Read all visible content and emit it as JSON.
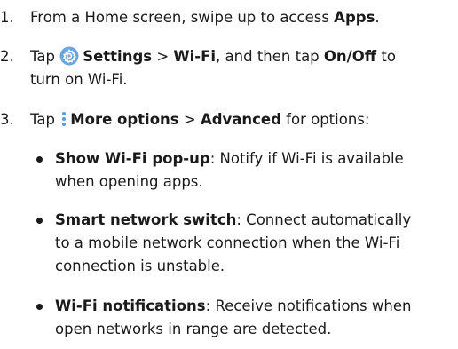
{
  "steps": [
    {
      "number": "1.",
      "pre": "From a Home screen, swipe up to access ",
      "bold1": "Apps",
      "post": "."
    },
    {
      "number": "2.",
      "pre": "Tap ",
      "icon": "settings-gear-icon",
      "icon_color": "#5b9bd5",
      "bold1": "Settings",
      "sep1": " > ",
      "bold2": "Wi-Fi",
      "mid": ", and then tap ",
      "bold3": "On/Off",
      "mid2": " to",
      "line2": "turn on Wi-Fi."
    },
    {
      "number": "3.",
      "pre": "Tap ",
      "icon": "more-options-icon",
      "icon_color": "#5b9bd5",
      "bold1": "More options",
      "sep1": " > ",
      "bold2": "Advanced",
      "post": " for options:"
    }
  ],
  "bullets": [
    {
      "term": "Show Wi-Fi pop-up",
      "line1": ": Notify if Wi-Fi is available",
      "line2": "when opening apps."
    },
    {
      "term": "Smart network switch",
      "line1": ": Connect automatically",
      "line2": "to a mobile network connection when the Wi-Fi",
      "line3": "connection is unstable."
    },
    {
      "term": "Wi-Fi notifications",
      "line1": ": Receive notifications when",
      "line2": "open networks in range are detected."
    }
  ]
}
